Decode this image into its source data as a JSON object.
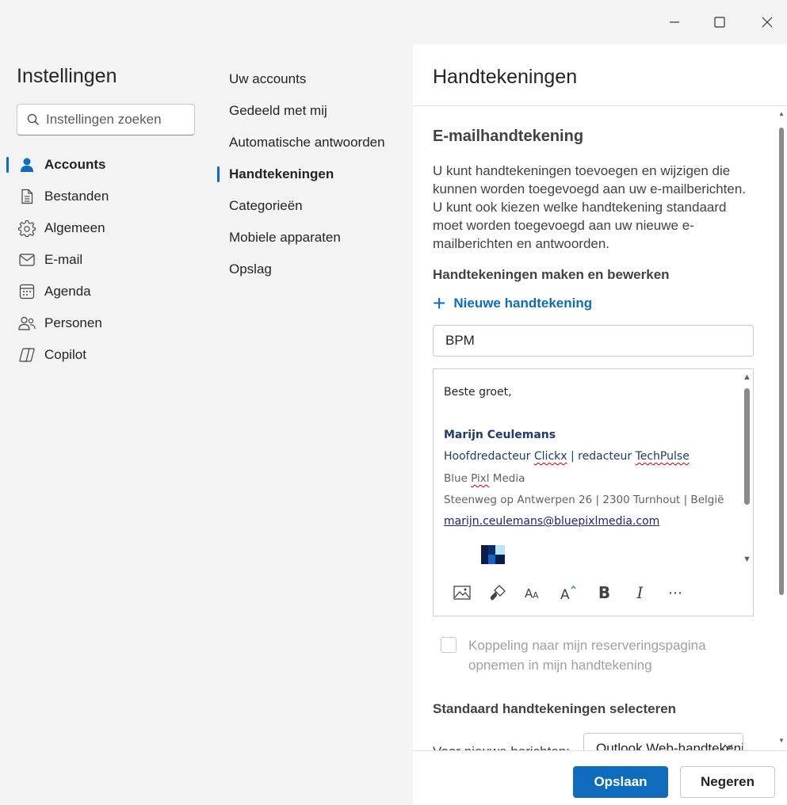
{
  "window": {
    "minimize_icon": "minimize-icon",
    "maximize_icon": "maximize-icon",
    "close_icon": "close-icon"
  },
  "left": {
    "title": "Instellingen",
    "search_placeholder": "Instellingen zoeken",
    "items": [
      {
        "label": "Accounts",
        "icon": "person-icon",
        "active": true
      },
      {
        "label": "Bestanden",
        "icon": "document-icon"
      },
      {
        "label": "Algemeen",
        "icon": "gear-icon"
      },
      {
        "label": "E-mail",
        "icon": "mail-icon"
      },
      {
        "label": "Agenda",
        "icon": "calendar-icon"
      },
      {
        "label": "Personen",
        "icon": "people-icon"
      },
      {
        "label": "Copilot",
        "icon": "copilot-icon"
      }
    ]
  },
  "middle": {
    "items": [
      {
        "label": "Uw accounts"
      },
      {
        "label": "Gedeeld met mij"
      },
      {
        "label": "Automatische antwoorden"
      },
      {
        "label": "Handtekeningen",
        "active": true
      },
      {
        "label": "Categorieën"
      },
      {
        "label": "Mobiele apparaten"
      },
      {
        "label": "Opslag"
      }
    ]
  },
  "panel": {
    "title": "Handtekeningen",
    "section_title": "E-mailhandtekening",
    "description": "U kunt handtekeningen toevoegen en wijzigen die kunnen worden toegevoegd aan uw e-mailberichten. U kunt ook kiezen welke handtekening standaard moet worden toegevoegd aan uw nieuwe e-mailberichten en antwoorden.",
    "create_heading": "Handtekeningen maken en bewerken",
    "new_signature": "Nieuwe handtekening",
    "signature_name": "BPM",
    "signature": {
      "greeting": "Beste groet,",
      "name": "Marijn Ceulemans",
      "role_1": "Hoofdredacteur ",
      "role_clickx": "Clickx",
      "role_2": " | redacteur ",
      "role_techpulse": "TechPulse",
      "company_1": "Blue ",
      "company_pixl": "Pixl",
      "company_2": " Media",
      "address": "Steenweg op Antwerpen 26 | 2300 Turnhout | België",
      "email": "marijn.ceulemans@bluepixlmedia.com"
    },
    "toolbar": [
      "image-icon",
      "format-painter-icon",
      "font-size-icon",
      "font-grow-icon",
      "bold-icon",
      "italic-icon",
      "more-icon"
    ],
    "booking_checkbox_label": "Koppeling naar mijn reserveringspagina opnemen in mijn handtekening",
    "booking_checked": false,
    "defaults_heading": "Standaard handtekeningen selecteren",
    "new_messages_label": "Voor nieuwe berichten:",
    "new_messages_value": "Outlook Web-handtekening",
    "save_label": "Opslaan",
    "discard_label": "Negeren"
  },
  "colors": {
    "accent": "#0f6cbd",
    "signature_blue": "#1e3a6e"
  }
}
